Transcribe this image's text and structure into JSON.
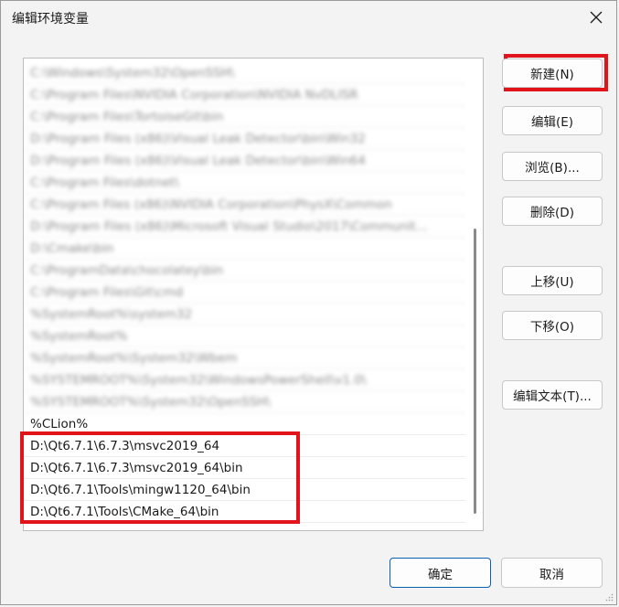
{
  "window": {
    "title": "编辑环境变量",
    "close_icon": "close-icon"
  },
  "list": {
    "items": [
      {
        "text": "C:\\Windows\\System32\\OpenSSH\\",
        "obscured": true
      },
      {
        "text": "C:\\Program Files\\NVIDIA Corporation\\NVIDIA NvDLISR",
        "obscured": true
      },
      {
        "text": "C:\\Program Files\\TortoiseGit\\bin",
        "obscured": true
      },
      {
        "text": "D:\\Program Files (x86)\\Visual Leak Detector\\bin\\Win32",
        "obscured": true
      },
      {
        "text": "D:\\Program Files (x86)\\Visual Leak Detector\\bin\\Win64",
        "obscured": true
      },
      {
        "text": "C:\\Program Files\\dotnet\\",
        "obscured": true
      },
      {
        "text": "C:\\Program Files (x86)\\NVIDIA Corporation\\PhysX\\Common",
        "obscured": true
      },
      {
        "text": "D:\\Program Files (x86)\\Microsoft Visual Studio\\2017\\Communit...",
        "obscured": true
      },
      {
        "text": "D:\\Cmake\\bin",
        "obscured": true
      },
      {
        "text": "C:\\ProgramData\\chocolatey\\bin",
        "obscured": true
      },
      {
        "text": "C:\\Program Files\\Git\\cmd",
        "obscured": true
      },
      {
        "text": "%SystemRoot%\\system32",
        "obscured": true
      },
      {
        "text": "%SystemRoot%",
        "obscured": true
      },
      {
        "text": "%SystemRoot%\\System32\\Wbem",
        "obscured": true
      },
      {
        "text": "%SYSTEMROOT%\\System32\\WindowsPowerShell\\v1.0\\",
        "obscured": true
      },
      {
        "text": "%SYSTEMROOT%\\System32\\OpenSSH\\",
        "obscured": true
      },
      {
        "text": "%CLion%",
        "obscured": false
      },
      {
        "text": "D:\\Qt6.7.1\\6.7.3\\msvc2019_64",
        "obscured": false
      },
      {
        "text": "D:\\Qt6.7.1\\6.7.3\\msvc2019_64\\bin",
        "obscured": false
      },
      {
        "text": "D:\\Qt6.7.1\\Tools\\mingw1120_64\\bin",
        "obscured": false
      },
      {
        "text": "D:\\Qt6.7.1\\Tools\\CMake_64\\bin",
        "obscured": false
      }
    ]
  },
  "buttons": {
    "new": "新建(N)",
    "edit": "编辑(E)",
    "browse": "浏览(B)...",
    "delete": "删除(D)",
    "move_up": "上移(U)",
    "move_down": "下移(O)",
    "edit_text": "编辑文本(T)...",
    "ok": "确定",
    "cancel": "取消"
  },
  "colors": {
    "highlight": "#e1141c",
    "primary_border": "#0a5fb4"
  }
}
